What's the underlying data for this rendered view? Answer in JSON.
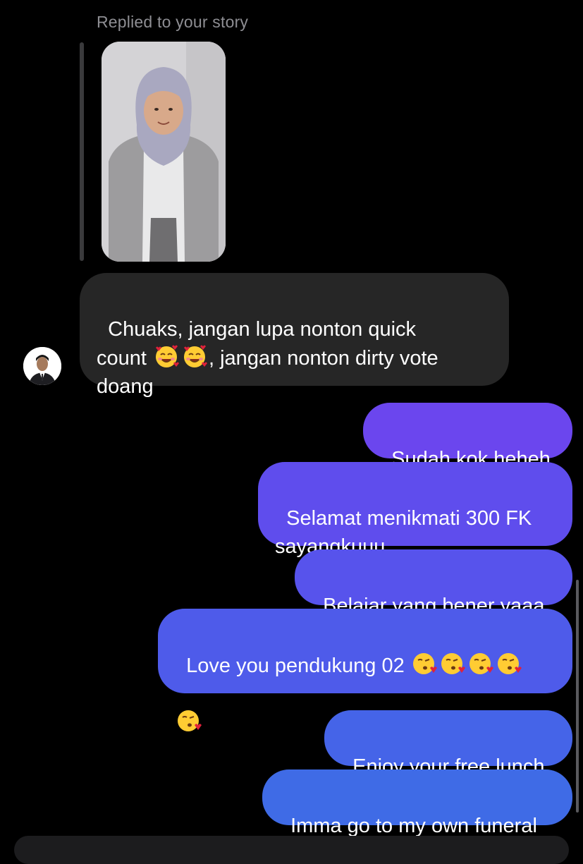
{
  "reply_context": {
    "label": "Replied to your story"
  },
  "incoming_messages": [
    {
      "text_part1": "Chuaks, jangan lupa nonton quick\ncount ",
      "emoji1": "smiling-face-with-hearts-icon",
      "emoji2": "smiling-face-with-hearts-icon",
      "text_part2": ", jangan nonton dirty vote\ndoang"
    }
  ],
  "outgoing_messages": [
    {
      "text": "Sudah kok heheh"
    },
    {
      "text": "Selamat menikmati 300 FK\nsayangkuuu"
    },
    {
      "text": "Belajar yang bener yaaa"
    },
    {
      "text": "Love you pendukung 02 ",
      "emoji_count": 5,
      "emoji": "face-blowing-a-kiss-icon"
    },
    {
      "text": "Enjoy your free lunch"
    },
    {
      "text": "Imma go to my own funeral"
    }
  ],
  "colors": {
    "background": "#000000",
    "incoming_bubble": "#262626",
    "outgoing_gradient_top": "#7a3ff0",
    "outgoing_gradient_bottom": "#3f6be6",
    "secondary_text": "#8e8e93"
  }
}
